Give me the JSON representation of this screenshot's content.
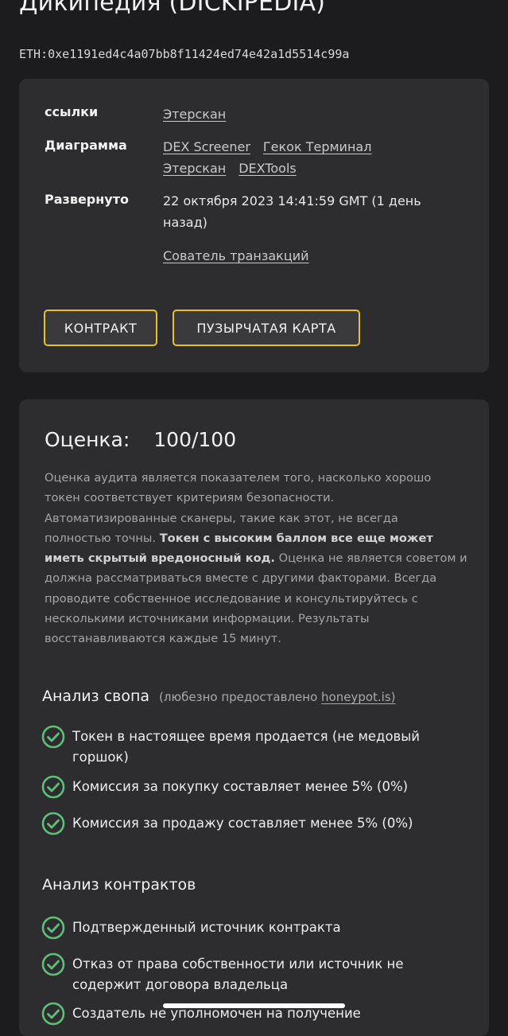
{
  "header": {
    "title": "Дикипедия (DICKIPEDIA)",
    "address": "ETH:0xe1191ed4c4a07bb8f11424ed74e42a1d5514c99a"
  },
  "info": {
    "links_label": "ссылки",
    "links": [
      "Этерскан"
    ],
    "chart_label": "Диаграмма",
    "chart_links": [
      "DEX Screener",
      "Гекок Терминал",
      "Этерскан",
      "DEXTools"
    ],
    "deployed_label": "Развернуто",
    "deployed_value": "22 октября 2023 14:41:59 GMT (1 день назад)",
    "creator_tx": "Сователь транзакций",
    "contract_button": "КОНТРАКТ",
    "bubblemap_button": "ПУЗЫРЧАТАЯ КАРТА"
  },
  "score": {
    "label": "Оценка:",
    "value": "100/100",
    "description_1": "Оценка аудита является показателем того, насколько хорошо токен соответствует критериям безопасности. Автоматизированные сканеры, такие как этот, не всегда полностью точны.",
    "description_bold": "Токен с высоким баллом все еще может иметь скрытый вредоносный код.",
    "description_2": "Оценка не является советом и должна рассматриваться вместе с другими факторами. Всегда проводите собственное исследование и консультируйтесь с несколькими источниками информации. Результаты восстанавливаются каждые 15 минут."
  },
  "swap_analysis": {
    "title": "Анализ свопа",
    "note_prefix": "(любезно предоставлено",
    "note_link": "honeypot.is)",
    "items": [
      "Токен в настоящее время продается (не медовый горшок)",
      "Комиссия за покупку составляет менее 5% (0%)",
      "Комиссия за продажу составляет менее 5% (0%)"
    ]
  },
  "contract_analysis": {
    "title": "Анализ контрактов",
    "items": [
      "Подтвержденный источник контракта",
      "Отказ от права собственности или источник не содержит договора владельца",
      "Создатель не уполномочен на получение"
    ]
  },
  "colors": {
    "background": "#1c1c1e",
    "card": "#2d2d2f",
    "button_border": "#e6c12f",
    "check_green": "#5fbf78"
  },
  "icons": {
    "check": "check-circle-icon"
  }
}
